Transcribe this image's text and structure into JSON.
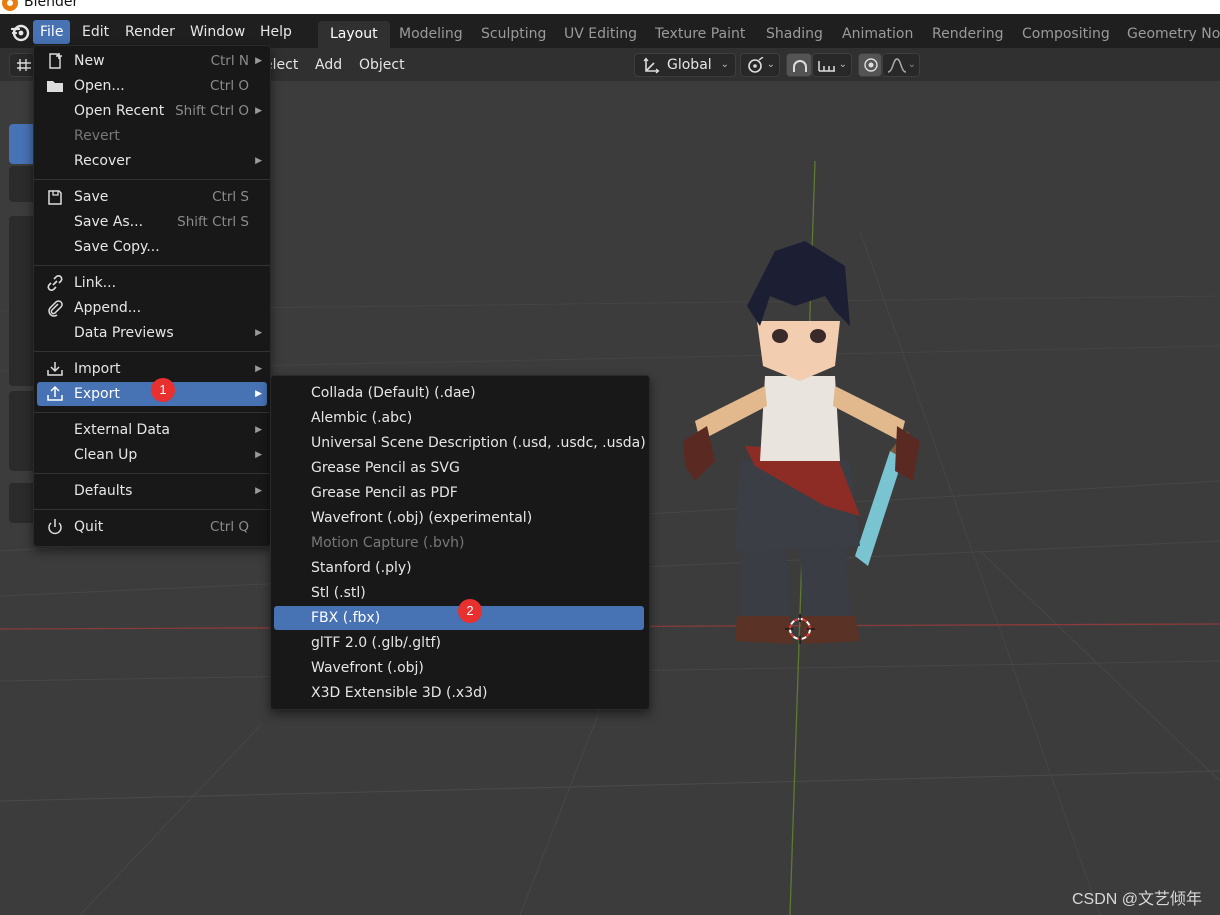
{
  "window": {
    "title": "Blender"
  },
  "menubar": {
    "items": [
      {
        "label": "File",
        "active": true
      },
      {
        "label": "Edit"
      },
      {
        "label": "Render"
      },
      {
        "label": "Window"
      },
      {
        "label": "Help"
      }
    ]
  },
  "workspaces": {
    "tabs": [
      {
        "label": "Layout",
        "active": true
      },
      {
        "label": "Modeling"
      },
      {
        "label": "Sculpting"
      },
      {
        "label": "UV Editing"
      },
      {
        "label": "Texture Paint"
      },
      {
        "label": "Shading"
      },
      {
        "label": "Animation"
      },
      {
        "label": "Rendering"
      },
      {
        "label": "Compositing"
      },
      {
        "label": "Geometry Noc"
      }
    ]
  },
  "header": {
    "select_label": "elect",
    "add_label": "Add",
    "object_label": "Object",
    "transform_orientation": "Global"
  },
  "file_menu": {
    "items": [
      {
        "label": "New",
        "shortcut": "Ctrl N",
        "icon": "new-file-icon",
        "submenu": true
      },
      {
        "label": "Open...",
        "shortcut": "Ctrl O",
        "icon": "folder-icon"
      },
      {
        "label": "Open Recent",
        "shortcut": "Shift Ctrl O",
        "submenu": true
      },
      {
        "label": "Revert",
        "disabled": true
      },
      {
        "label": "Recover",
        "submenu": true
      },
      {
        "label": "Save",
        "shortcut": "Ctrl S",
        "icon": "save-icon"
      },
      {
        "label": "Save As...",
        "shortcut": "Shift Ctrl S"
      },
      {
        "label": "Save Copy..."
      },
      {
        "label": "Link...",
        "icon": "link-icon"
      },
      {
        "label": "Append...",
        "icon": "append-icon"
      },
      {
        "label": "Data Previews",
        "submenu": true
      },
      {
        "label": "Import",
        "icon": "import-icon",
        "submenu": true
      },
      {
        "label": "Export",
        "icon": "export-icon",
        "submenu": true,
        "highlighted": true
      },
      {
        "label": "External Data",
        "submenu": true
      },
      {
        "label": "Clean Up",
        "submenu": true
      },
      {
        "label": "Defaults",
        "submenu": true
      },
      {
        "label": "Quit",
        "shortcut": "Ctrl Q",
        "icon": "power-icon"
      }
    ]
  },
  "export_menu": {
    "items": [
      {
        "label": "Collada (Default) (.dae)"
      },
      {
        "label": "Alembic (.abc)"
      },
      {
        "label": "Universal Scene Description (.usd, .usdc, .usda)"
      },
      {
        "label": "Grease Pencil as SVG"
      },
      {
        "label": "Grease Pencil as PDF"
      },
      {
        "label": "Wavefront (.obj) (experimental)"
      },
      {
        "label": "Motion Capture (.bvh)",
        "disabled": true
      },
      {
        "label": "Stanford (.ply)"
      },
      {
        "label": "Stl (.stl)"
      },
      {
        "label": "FBX (.fbx)",
        "highlighted": true
      },
      {
        "label": "glTF 2.0 (.glb/.gltf)"
      },
      {
        "label": "Wavefront (.obj)"
      },
      {
        "label": "X3D Extensible 3D (.x3d)"
      }
    ]
  },
  "annotations": {
    "step1": "1",
    "step2": "2"
  },
  "watermark": "CSDN @文艺倾年",
  "colors": {
    "accent": "#4772b3",
    "badge": "#e8302f",
    "menu_bg": "#181818",
    "viewport_bg": "#3c3c3c"
  }
}
